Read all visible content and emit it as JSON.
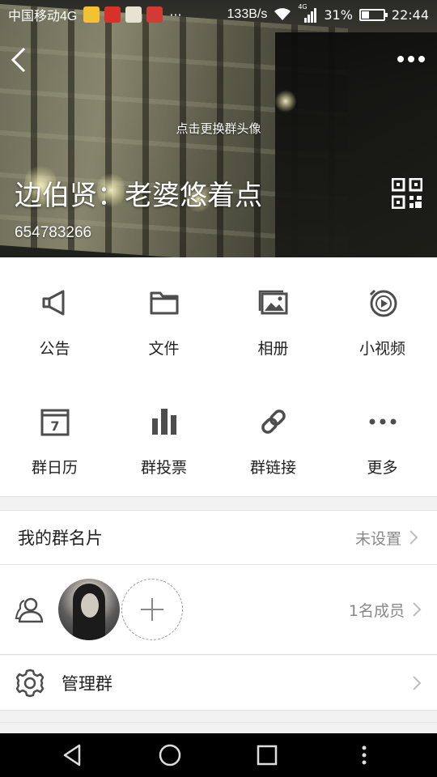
{
  "status_bar": {
    "carrier": "中国移动4G",
    "more": "···",
    "net_speed": "133B/s",
    "network": "4G",
    "battery": "31%",
    "battery_level": 0.31,
    "time": "22:44"
  },
  "header": {
    "avatar_hint": "点击更换群头像",
    "group_name": "边伯贤：老婆悠着点",
    "group_id": "654783266"
  },
  "grid": {
    "items": [
      {
        "label": "公告",
        "icon": "megaphone-icon"
      },
      {
        "label": "文件",
        "icon": "folder-icon"
      },
      {
        "label": "相册",
        "icon": "album-icon"
      },
      {
        "label": "小视频",
        "icon": "video-icon"
      },
      {
        "label": "群日历",
        "icon": "calendar-icon",
        "day": "7"
      },
      {
        "label": "群投票",
        "icon": "vote-icon"
      },
      {
        "label": "群链接",
        "icon": "link-icon"
      },
      {
        "label": "更多",
        "icon": "more-icon"
      }
    ]
  },
  "card_row": {
    "title": "我的群名片",
    "value": "未设置"
  },
  "members_row": {
    "count": "1名成员"
  },
  "manage_row": {
    "title": "管理群"
  },
  "colors": {
    "icon": "#4d4d4d",
    "text": "#222222",
    "secondary": "#888888"
  }
}
